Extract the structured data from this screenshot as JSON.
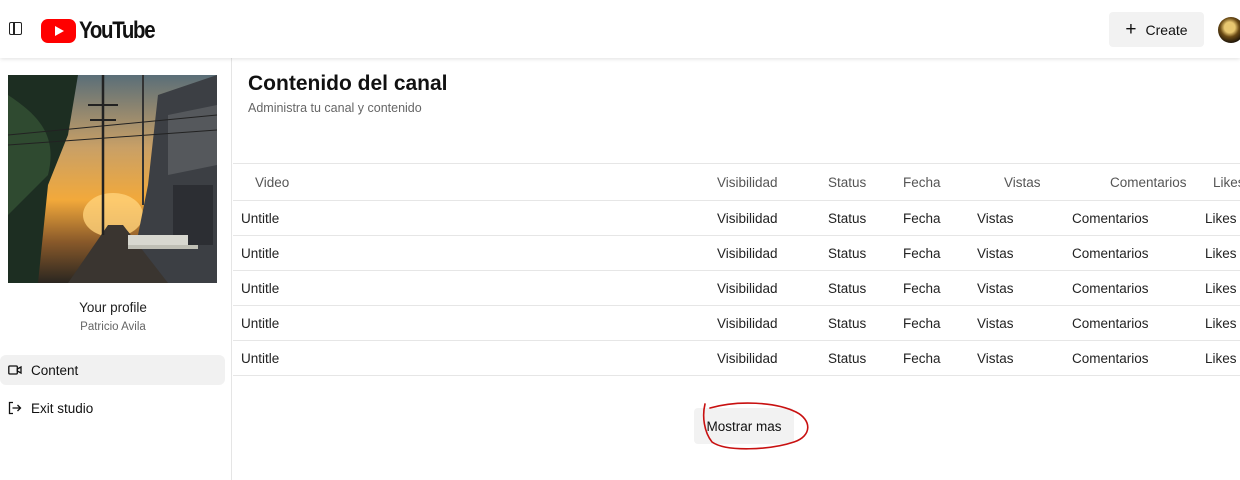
{
  "header": {
    "brand": "YouTube",
    "create_label": "Create",
    "create_icon": "plus-icon",
    "toggle_icon": "sidebar-toggle-icon"
  },
  "sidebar": {
    "profile_label": "Your profile",
    "username": "Patricio Avila",
    "items": [
      {
        "label": "Content",
        "icon": "video-camera-icon",
        "active": true
      },
      {
        "label": "Exit studio",
        "icon": "exit-icon",
        "active": false
      }
    ]
  },
  "main": {
    "title": "Contenido del canal",
    "subtitle": "Administra tu canal y contenido",
    "columns": [
      "Video",
      "Visibilidad",
      "Status",
      "Fecha",
      "Vistas",
      "Comentarios",
      "Likes"
    ],
    "rows": [
      [
        "Untitle",
        "Visibilidad",
        "Status",
        "Fecha",
        "Vistas",
        "Comentarios",
        "Likes"
      ],
      [
        "Untitle",
        "Visibilidad",
        "Status",
        "Fecha",
        "Vistas",
        "Comentarios",
        "Likes"
      ],
      [
        "Untitle",
        "Visibilidad",
        "Status",
        "Fecha",
        "Vistas",
        "Comentarios",
        "Likes"
      ],
      [
        "Untitle",
        "Visibilidad",
        "Status",
        "Fecha",
        "Vistas",
        "Comentarios",
        "Likes"
      ],
      [
        "Untitle",
        "Visibilidad",
        "Status",
        "Fecha",
        "Vistas",
        "Comentarios",
        "Likes"
      ]
    ],
    "more_label": "Mostrar mas"
  },
  "colors": {
    "brand_red": "#ff0000",
    "annotation_red": "#c81010"
  }
}
